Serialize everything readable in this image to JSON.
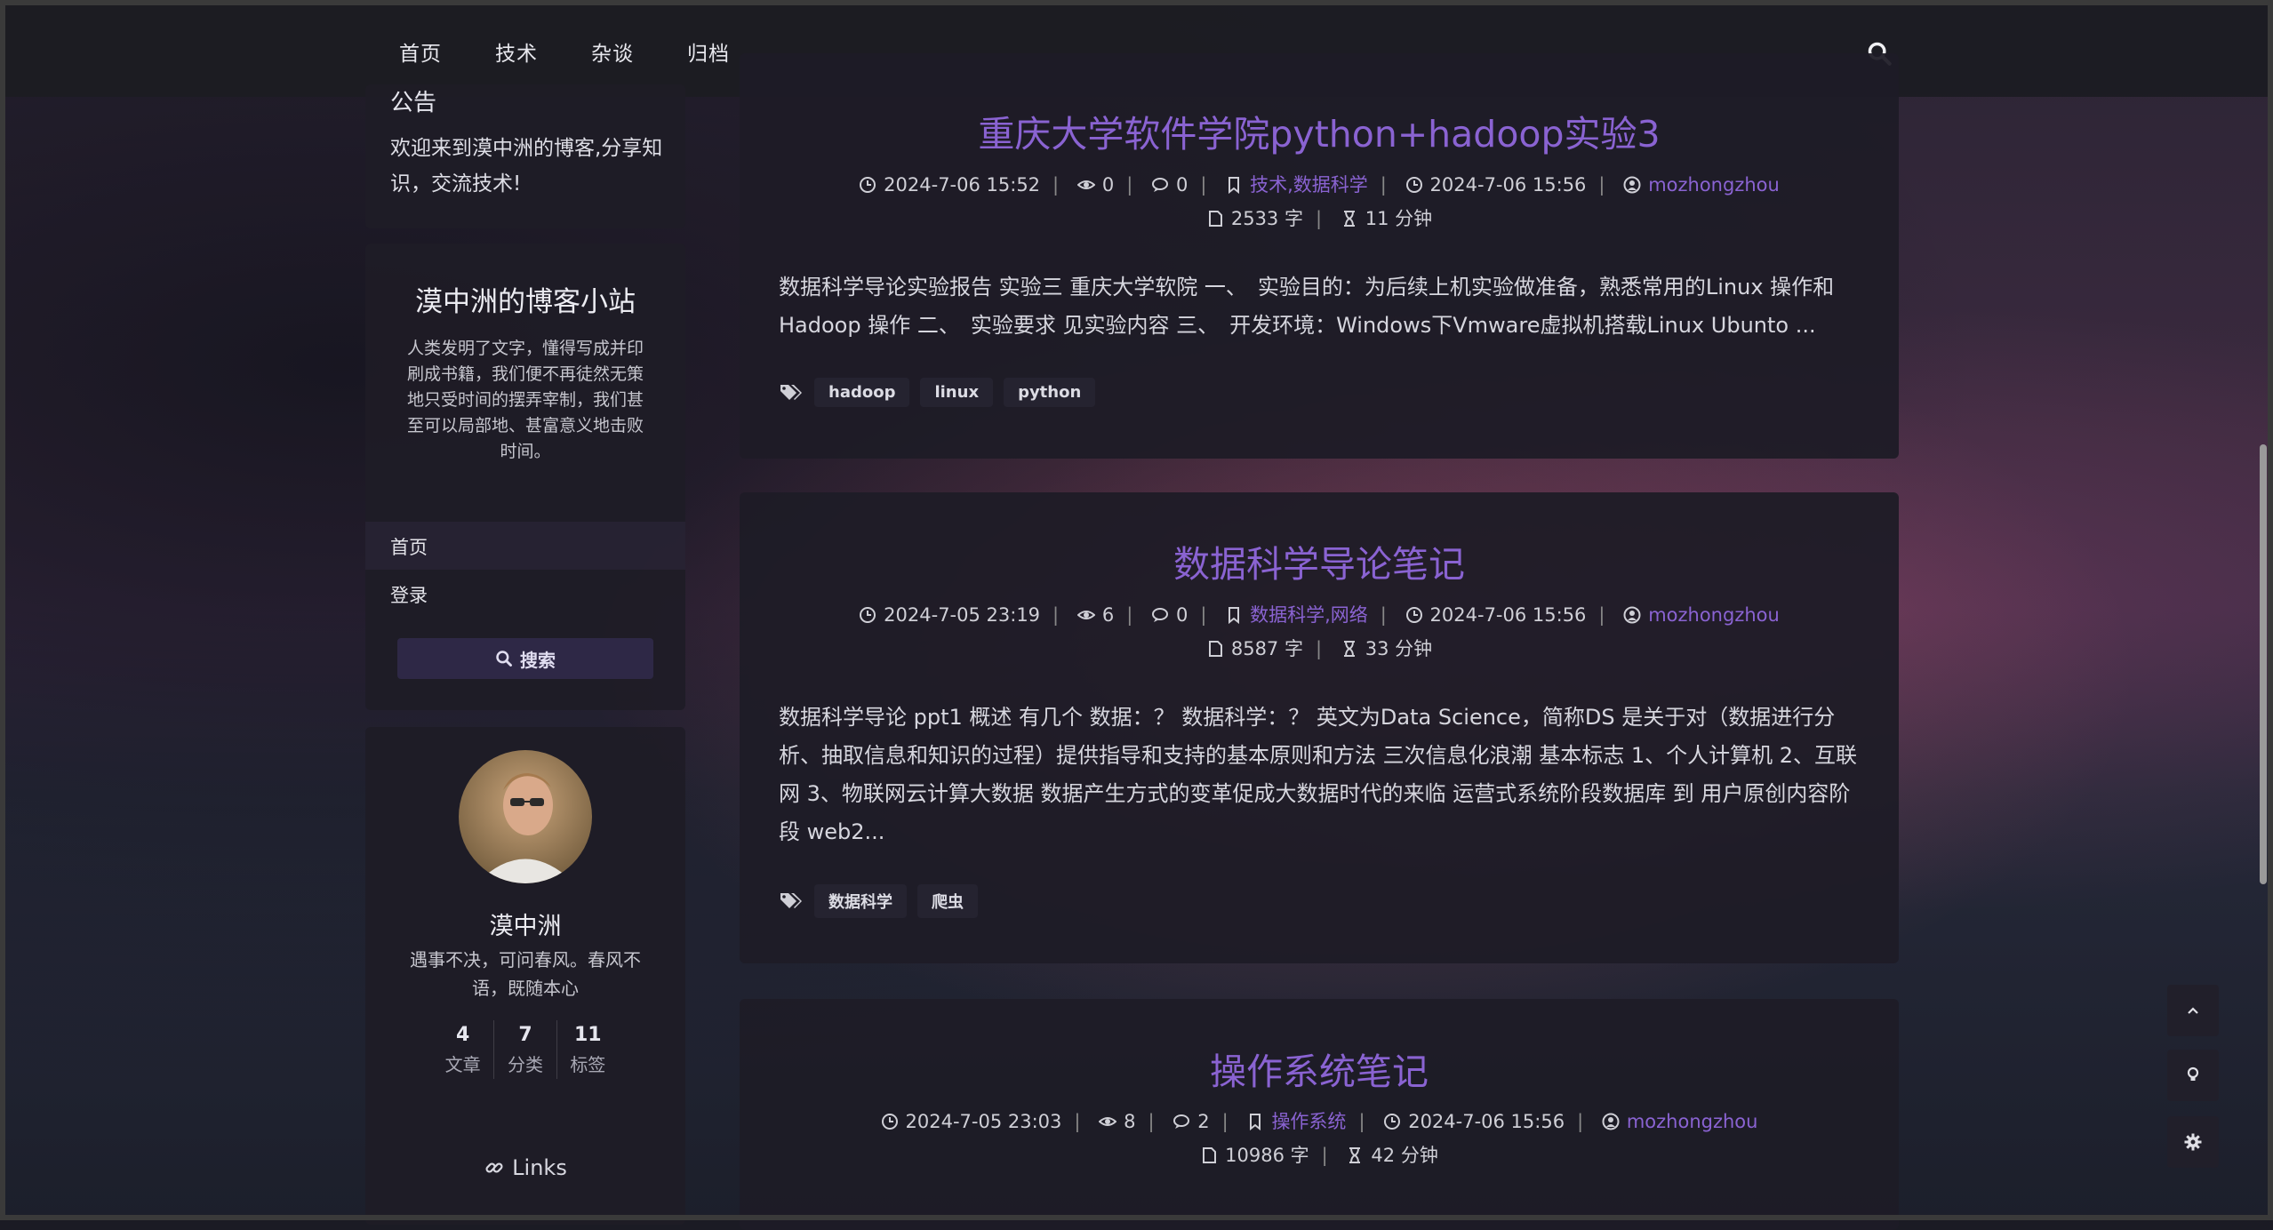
{
  "nav": {
    "items": [
      "首页",
      "技术",
      "杂谈",
      "归档"
    ]
  },
  "sidebar": {
    "notice": {
      "title": "公告",
      "text": "欢迎来到漠中洲的博客,分享知识，交流技术!"
    },
    "site": {
      "name": "漠中洲的博客小站",
      "motto": "人类发明了文字，懂得写成并印刷成书籍，我们便不再徒然无策地只受时间的摆弄宰制，我们甚至可以局部地、甚富意义地击败时间。",
      "menu_home": "首页",
      "menu_login": "登录",
      "search_label": "搜索"
    },
    "profile": {
      "name": "漠中洲",
      "bio": "遇事不决，可问春风。春风不语，既随本心",
      "stats": [
        {
          "num": "4",
          "label": "文章"
        },
        {
          "num": "7",
          "label": "分类"
        },
        {
          "num": "11",
          "label": "标签"
        }
      ],
      "links_label": "Links"
    }
  },
  "posts": [
    {
      "title": "重庆大学软件学院python+hadoop实验3",
      "created": "2024-7-06 15:52",
      "views": "0",
      "comments": "0",
      "categories": "技术,数据科学",
      "updated": "2024-7-06 15:56",
      "author": "mozhongzhou",
      "words": "2533 字",
      "read_time": "11 分钟",
      "excerpt": "数据科学导论实验报告 实验三 重庆大学软院 一、　实验目的：为后续上机实验做准备，熟悉常用的Linux 操作和Hadoop 操作 二、　实验要求 见实验内容 三、　开发环境：Windows下Vmware虚拟机搭载Linux Ubunto ...",
      "tags": [
        "hadoop",
        "linux",
        "python"
      ]
    },
    {
      "title": "数据科学导论笔记",
      "created": "2024-7-05 23:19",
      "views": "6",
      "comments": "0",
      "categories": "数据科学,网络",
      "updated": "2024-7-06 15:56",
      "author": "mozhongzhou",
      "words": "8587 字",
      "read_time": "33 分钟",
      "excerpt": "数据科学导论 ppt1 概述 有几个 数据：？ 数据科学：？ 英文为Data Science，简称DS 是关于对（数据进行分析、抽取信息和知识的过程）提供指导和支持的基本原则和方法 三次信息化浪潮 基本标志 1、个人计算机 2、互联网 3、物联网云计算大数据 数据产生方式的变革促成大数据时代的来临 运营式系统阶段数据库 到 用户原创内容阶段 web2...",
      "tags": [
        "数据科学",
        "爬虫"
      ]
    },
    {
      "title": "操作系统笔记",
      "created": "2024-7-05 23:03",
      "views": "8",
      "comments": "2",
      "categories": "操作系统",
      "updated": "2024-7-06 15:56",
      "author": "mozhongzhou",
      "words": "10986 字",
      "read_time": "42 分钟"
    }
  ],
  "colors": {
    "accent": "#8a63d2",
    "card": "#1e1c26"
  }
}
